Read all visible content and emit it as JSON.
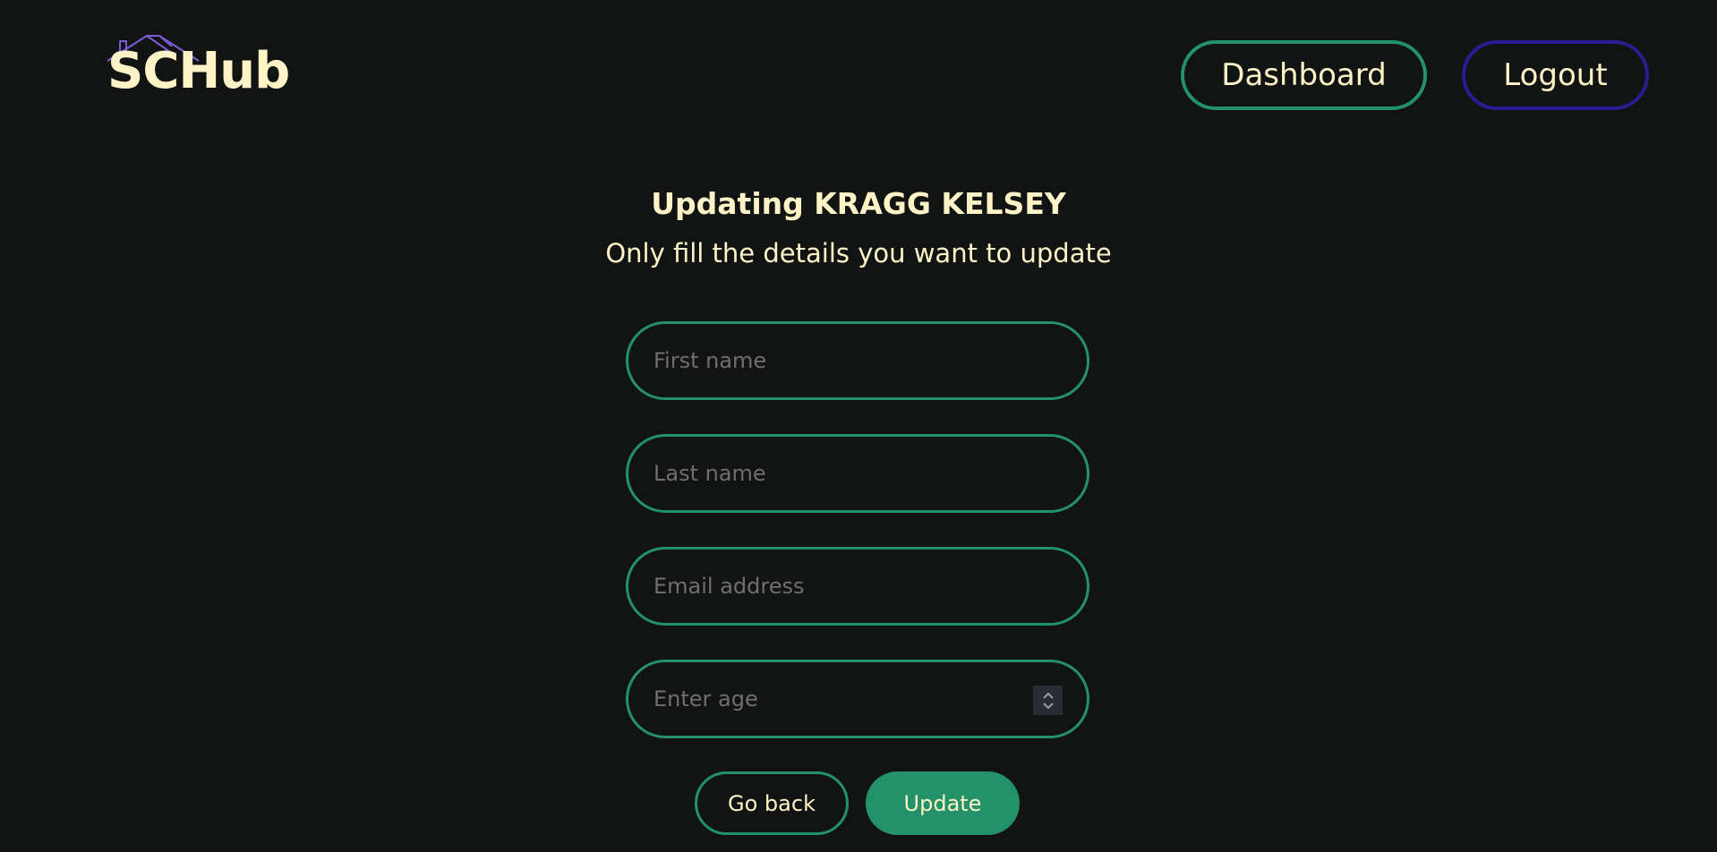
{
  "header": {
    "logo_text": "SCHub",
    "nav": {
      "dashboard_label": "Dashboard",
      "logout_label": "Logout"
    }
  },
  "main": {
    "title": "Updating KRAGG KELSEY",
    "subtitle": "Only fill the details you want to update",
    "fields": {
      "first_name": {
        "placeholder": "First name",
        "value": ""
      },
      "last_name": {
        "placeholder": "Last name",
        "value": ""
      },
      "email": {
        "placeholder": "Email address",
        "value": ""
      },
      "age": {
        "placeholder": "Enter age",
        "value": ""
      }
    },
    "actions": {
      "back_label": "Go back",
      "update_label": "Update"
    }
  },
  "icons": {
    "logo_roof": "house-roof-icon",
    "age_stepper": "chevron-up-down-icon"
  },
  "colors": {
    "background": "#121413",
    "text": "#fef3c7",
    "accent_green": "#23916a",
    "accent_purple": "#2c1b93",
    "roof_purple": "#7c5cd6",
    "placeholder": "#6f6f6b"
  }
}
